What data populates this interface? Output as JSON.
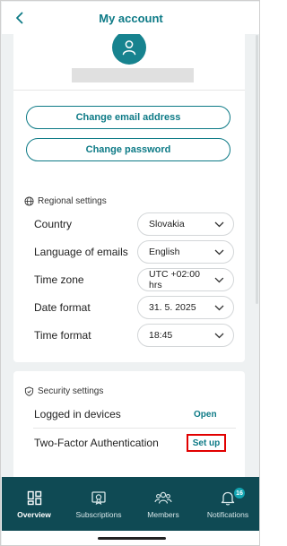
{
  "header": {
    "title": "My account",
    "back_icon": "chevron-left-icon"
  },
  "account": {
    "avatar_icon": "person-icon",
    "change_email_label": "Change email address",
    "change_password_label": "Change password"
  },
  "regional": {
    "heading": "Regional settings",
    "heading_icon": "globe-icon",
    "rows": [
      {
        "label": "Country",
        "value": "Slovakia"
      },
      {
        "label": "Language of emails",
        "value": "English"
      },
      {
        "label": "Time zone",
        "value": "UTC +02:00 hrs"
      },
      {
        "label": "Date format",
        "value": "31. 5. 2025"
      },
      {
        "label": "Time format",
        "value": "18:45"
      }
    ]
  },
  "security": {
    "heading": "Security settings",
    "heading_icon": "shield-icon",
    "logged_devices_label": "Logged in devices",
    "logged_devices_action": "Open",
    "two_factor_label": "Two-Factor Authentication",
    "two_factor_action": "Set up"
  },
  "nav": {
    "items": [
      {
        "label": "Overview",
        "icon": "dashboard-icon",
        "active": true
      },
      {
        "label": "Subscriptions",
        "icon": "subscriptions-icon",
        "active": false
      },
      {
        "label": "Members",
        "icon": "members-icon",
        "active": false
      },
      {
        "label": "Notifications",
        "icon": "bell-icon",
        "active": false,
        "badge": "16"
      }
    ]
  },
  "colors": {
    "accent": "#0d7a86",
    "nav_bg": "#0f4a54",
    "highlight": "#e10000"
  }
}
